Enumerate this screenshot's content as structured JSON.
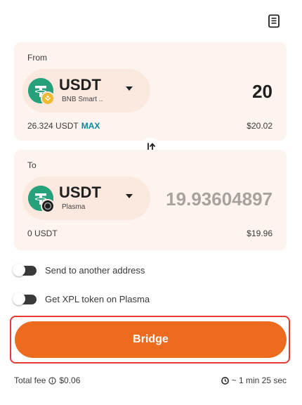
{
  "from": {
    "label": "From",
    "token": {
      "symbol": "USDT",
      "chain": "BNB Smart .."
    },
    "amount": "20",
    "balance": "26.324 USDT",
    "max_label": "MAX",
    "usd_value": "$20.02"
  },
  "to": {
    "label": "To",
    "token": {
      "symbol": "USDT",
      "chain": "Plasma"
    },
    "amount": "19.93604897",
    "balance": "0 USDT",
    "usd_value": "$19.96"
  },
  "options": {
    "send_to_another": {
      "label": "Send to another address",
      "enabled": false
    },
    "get_xpl": {
      "label": "Get XPL token on Plasma",
      "enabled": false
    }
  },
  "bridge_button": {
    "label": "Bridge"
  },
  "footer": {
    "fee_label": "Total fee",
    "fee_value": "$0.06",
    "eta": "~ 1 min 25 sec"
  },
  "colors": {
    "accent": "#ec6b1f",
    "usdt": "#26a17b",
    "bnb": "#f3ba2f",
    "max_link": "#0a8aa0",
    "highlight_frame": "#e53935"
  },
  "icons": {
    "history": "receipt-history-icon",
    "swap": "swap-direction-icon",
    "info": "info-icon",
    "clock": "clock-icon"
  }
}
